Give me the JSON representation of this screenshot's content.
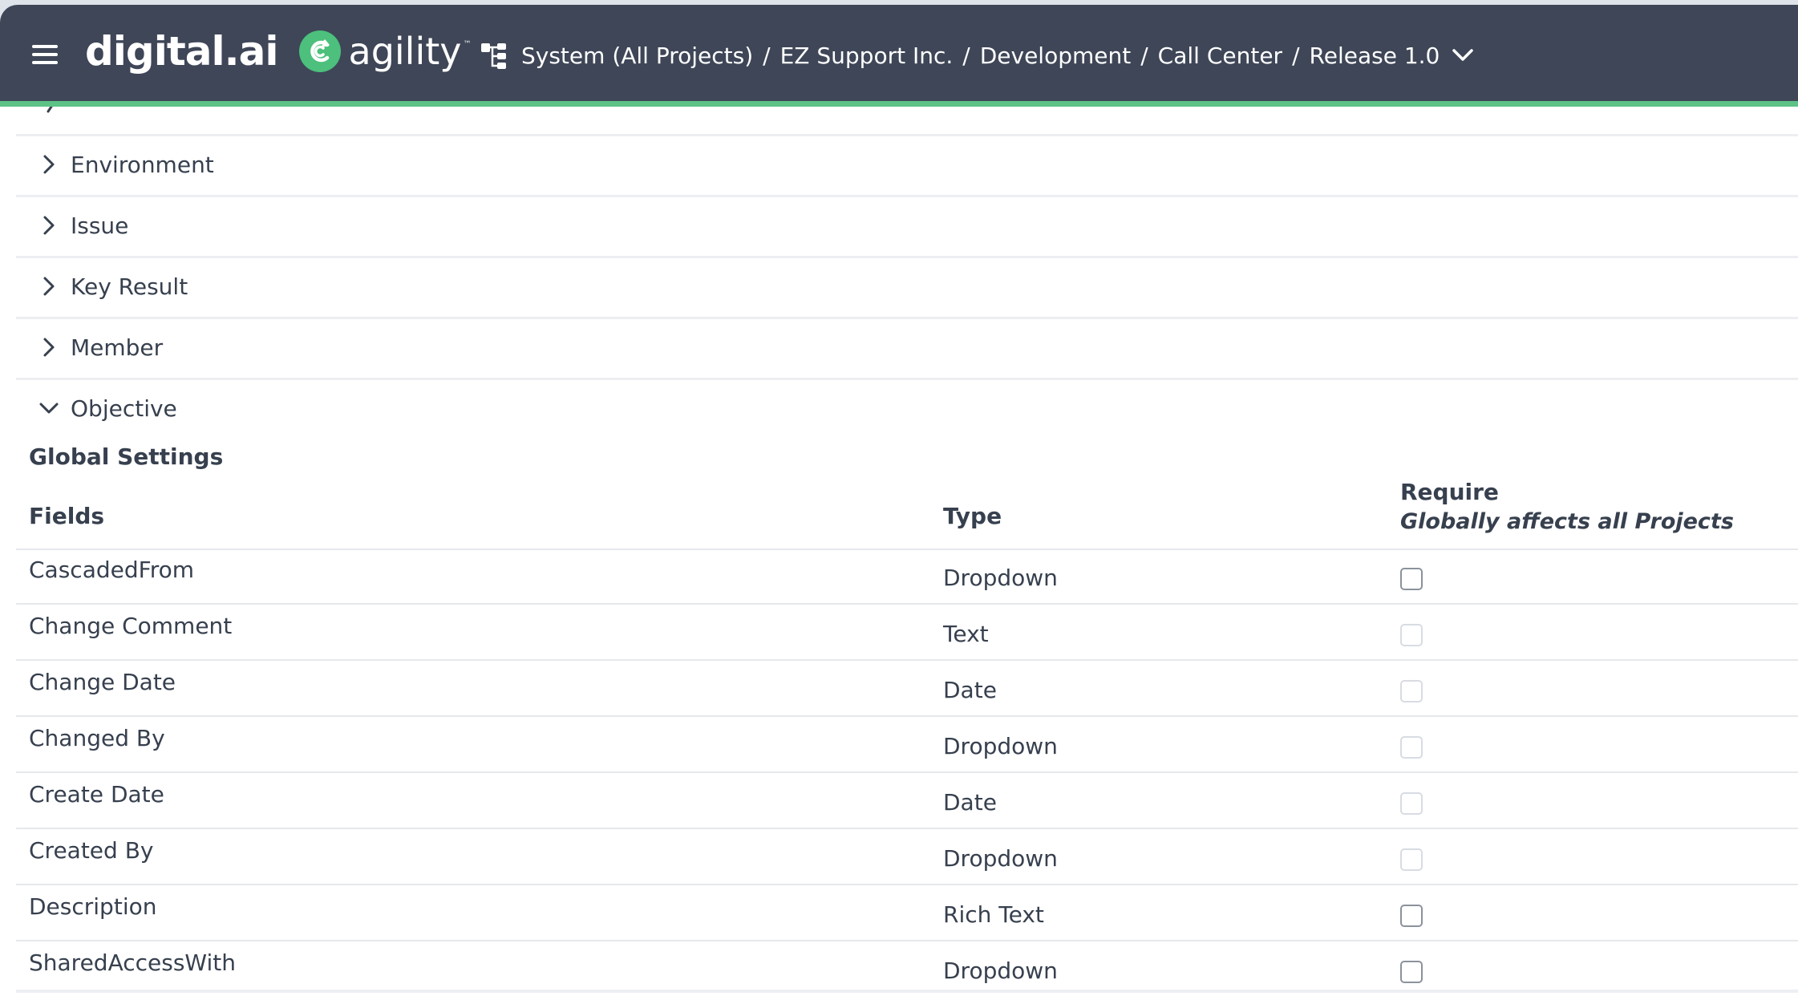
{
  "header": {
    "logo_text": "digital.ai",
    "product_name": "agility",
    "trademark": "™",
    "breadcrumb": [
      "System (All Projects)",
      "EZ Support Inc.",
      "Development",
      "Call Center",
      "Release 1.0"
    ],
    "separator": "/"
  },
  "sections": [
    {
      "label": "Environment",
      "expanded": false
    },
    {
      "label": "Issue",
      "expanded": false
    },
    {
      "label": "Key Result",
      "expanded": false
    },
    {
      "label": "Member",
      "expanded": false
    },
    {
      "label": "Objective",
      "expanded": true
    }
  ],
  "objective": {
    "global_settings_title": "Global Settings",
    "columns": {
      "fields": "Fields",
      "type": "Type",
      "require": "Require",
      "require_note": "Globally affects all Projects"
    },
    "rows": [
      {
        "field": "CascadedFrom",
        "type": "Dropdown",
        "required": false
      },
      {
        "field": "Change Comment",
        "type": "Text",
        "required": false
      },
      {
        "field": "Change Date",
        "type": "Date",
        "required": false
      },
      {
        "field": "Changed By",
        "type": "Dropdown",
        "required": false
      },
      {
        "field": "Create Date",
        "type": "Date",
        "required": false
      },
      {
        "field": "Created By",
        "type": "Dropdown",
        "required": false
      },
      {
        "field": "Description",
        "type": "Rich Text",
        "required": false
      },
      {
        "field": "SharedAccessWith",
        "type": "Dropdown",
        "required": false
      }
    ]
  },
  "colors": {
    "header_bg": "#3e4657",
    "accent": "#5cc286",
    "text": "#37404e"
  }
}
